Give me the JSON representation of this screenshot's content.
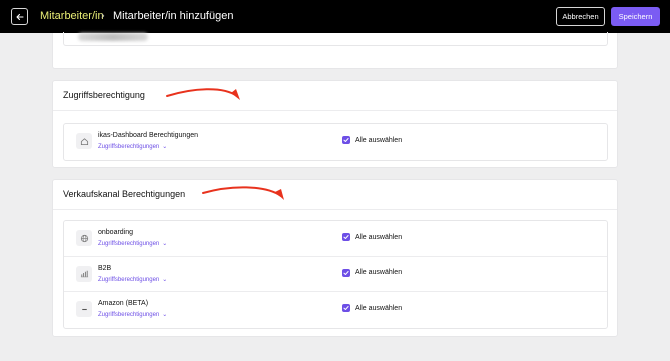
{
  "header": {
    "breadcrumb_parent": "Mitarbeiter/in",
    "breadcrumb_separator": "›",
    "page_title": "Mitarbeiter/in hinzufügen",
    "cancel_label": "Abbrechen",
    "save_label": "Speichern"
  },
  "access_section": {
    "title": "Zugriffsberechtigung",
    "rows": [
      {
        "name": "ikas-Dashboard Berechtigungen",
        "link": "Zugriffsberechtigungen",
        "select_all": "Alle auswählen",
        "checked": true,
        "icon": "home-icon"
      }
    ]
  },
  "sales_section": {
    "title": "Verkaufskanal Berechtigungen",
    "rows": [
      {
        "name": "onboarding",
        "link": "Zugriffsberechtigungen",
        "select_all": "Alle auswählen",
        "checked": true,
        "icon": "globe-icon"
      },
      {
        "name": "B2B",
        "link": "Zugriffsberechtigungen",
        "select_all": "Alle auswählen",
        "checked": true,
        "icon": "bar-chart-icon"
      },
      {
        "name": "Amazon (BETA)",
        "link": "Zugriffsberechtigungen",
        "select_all": "Alle auswählen",
        "checked": true,
        "icon": "dash-icon"
      }
    ]
  },
  "colors": {
    "accent": "#7b5cf3",
    "breadcrumb": "#e9ee75",
    "arrow": "#e8321d"
  }
}
